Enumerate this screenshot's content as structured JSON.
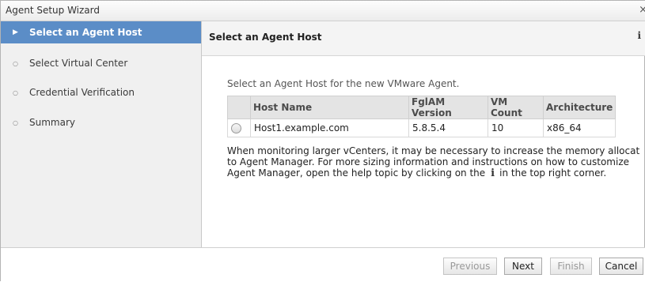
{
  "window": {
    "title": "Agent Setup Wizard",
    "close_glyph": "×"
  },
  "sidebar": {
    "steps": [
      {
        "label": "Select an Agent Host",
        "active": true
      },
      {
        "label": "Select Virtual Center",
        "active": false
      },
      {
        "label": "Credential Verification",
        "active": false
      },
      {
        "label": "Summary",
        "active": false
      }
    ]
  },
  "main": {
    "title": "Select an Agent Host",
    "info_glyph": "i",
    "instruction": "Select an Agent Host for the new VMware Agent.",
    "table": {
      "columns": [
        "",
        "Host Name",
        "FglAM Version",
        "VM Count",
        "Architecture"
      ],
      "rows": [
        {
          "selected": false,
          "host_name": "Host1.example.com",
          "fglam_version": "5.8.5.4",
          "vm_count": "10",
          "architecture": "x86_64"
        }
      ]
    },
    "note": {
      "line1": "When monitoring larger vCenters, it may be necessary to increase the memory allocat",
      "line2": "to Agent Manager. For more sizing information and instructions on how to customize",
      "line3_before": "Agent Manager, open the help topic by clicking on the",
      "line3_after": "in the top right corner."
    }
  },
  "footer": {
    "previous": "Previous",
    "next": "Next",
    "finish": "Finish",
    "cancel": "Cancel"
  }
}
